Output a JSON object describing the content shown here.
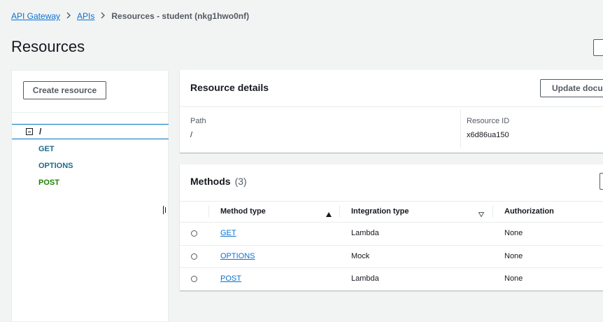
{
  "breadcrumb": {
    "items": [
      "API Gateway",
      "APIs"
    ],
    "current": "Resources - student (nkg1hwo0nf)"
  },
  "page": {
    "title": "Resources"
  },
  "left": {
    "create_label": "Create resource",
    "root": "/",
    "methods": [
      "GET",
      "OPTIONS",
      "POST"
    ]
  },
  "details": {
    "title": "Resource details",
    "update_label": "Update docu",
    "path_label": "Path",
    "path_value": "/",
    "id_label": "Resource ID",
    "id_value": "x6d86ua150"
  },
  "methods_card": {
    "title": "Methods",
    "count": "(3)",
    "headers": [
      "Method type",
      "Integration type",
      "Authorization"
    ],
    "rows": [
      {
        "method": "GET",
        "integration": "Lambda",
        "auth": "None"
      },
      {
        "method": "OPTIONS",
        "integration": "Mock",
        "auth": "None"
      },
      {
        "method": "POST",
        "integration": "Lambda",
        "auth": "None"
      }
    ]
  },
  "colors": {
    "link": "#0972d3",
    "accent": "#0073bb",
    "method_green": "#1d8102"
  },
  "icons": [
    "chevron-right-icon",
    "collapse-icon",
    "sort-asc-icon",
    "sort-desc-icon",
    "resize-handle-icon"
  ]
}
